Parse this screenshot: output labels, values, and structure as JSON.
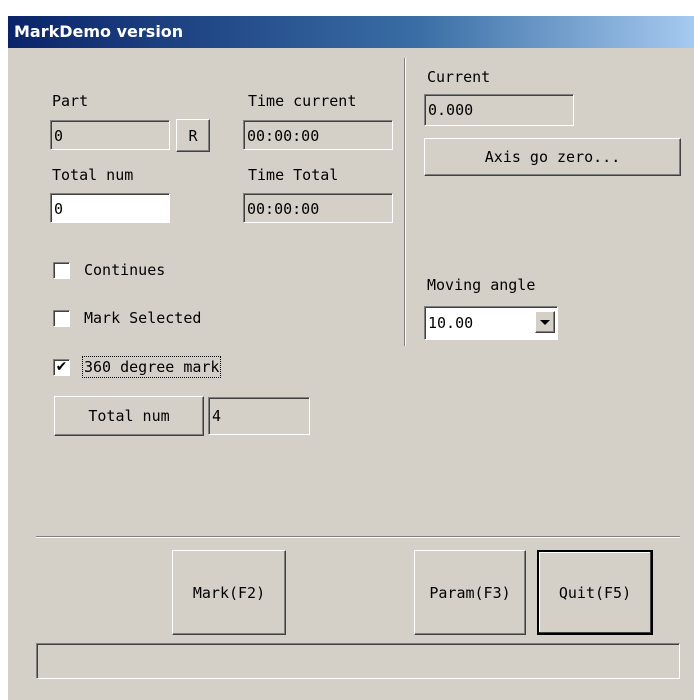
{
  "window": {
    "title": "MarkDemo version"
  },
  "left": {
    "part_label": "Part",
    "part_value": "0",
    "reset_label": "R",
    "time_current_label": "Time current",
    "time_current_value": "00:00:00",
    "total_num_label": "Total num",
    "total_num_value": "0",
    "time_total_label": "Time Total",
    "time_total_value": "00:00:00",
    "continues_label": "Continues",
    "continues_checked": false,
    "mark_selected_label": "Mark Selected",
    "mark_selected_checked": false,
    "degree_mark_label": "360 degree mark",
    "degree_mark_checked": true,
    "total_num_button_label": "Total num",
    "total_num_button_value": "4"
  },
  "right": {
    "current_label": "Current",
    "current_value": "0.000",
    "axis_zero_label": "Axis go zero...",
    "moving_angle_label": "Moving angle",
    "moving_angle_value": "10.00"
  },
  "buttons": {
    "mark": "Mark(F2)",
    "param": "Param(F3)",
    "quit": "Quit(F5)"
  },
  "status_text": "",
  "check_glyph": "✔"
}
